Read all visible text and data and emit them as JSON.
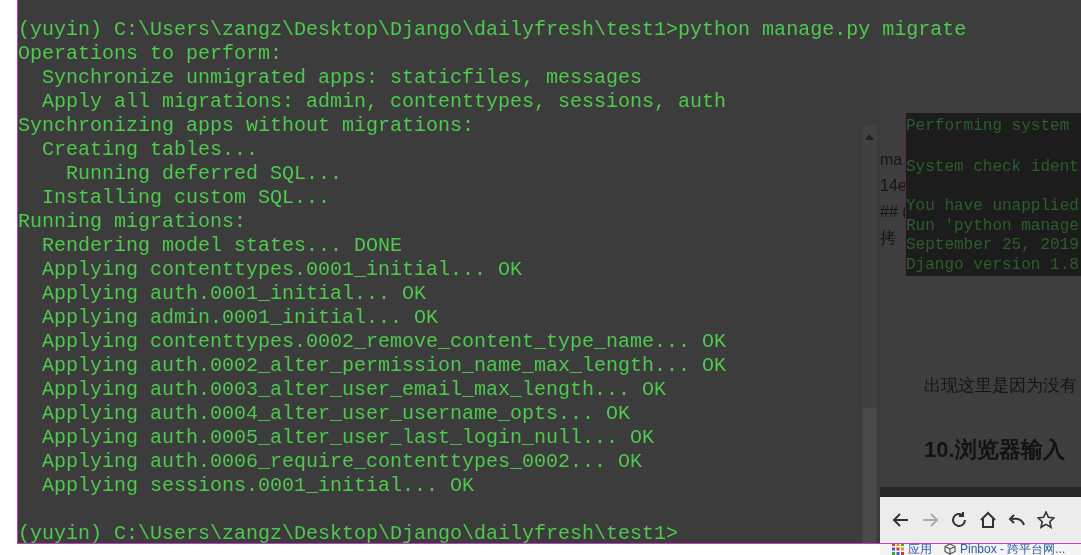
{
  "side_page": {
    "fragments": [
      "ma",
      "14e",
      "## (",
      "拷"
    ],
    "note": "出现这里是因为没有",
    "heading": "10.浏览器输入"
  },
  "server_console": {
    "lines": [
      "Performing system",
      "System check ident",
      "You have unapplied",
      "Run 'python manage",
      "September 25, 2019",
      "Django version 1.8"
    ]
  },
  "browser": {
    "bookmarks": [
      {
        "kind": "apps",
        "label": "应用"
      },
      {
        "kind": "page",
        "label": "Pinbox - 跨平台网..."
      }
    ]
  },
  "terminal": {
    "lines": [
      {
        "kind": "prompt",
        "text": "(yuyin) C:\\Users\\zangz\\Desktop\\Django\\dailyfresh\\test1>python manage.py migrate"
      },
      {
        "kind": "output",
        "text": "Operations to perform:"
      },
      {
        "kind": "output",
        "text": "  Synchronize unmigrated apps: staticfiles, messages"
      },
      {
        "kind": "output",
        "text": "  Apply all migrations: admin, contenttypes, sessions, auth"
      },
      {
        "kind": "output",
        "text": "Synchronizing apps without migrations:"
      },
      {
        "kind": "output",
        "text": "  Creating tables..."
      },
      {
        "kind": "output",
        "text": "    Running deferred SQL..."
      },
      {
        "kind": "output",
        "text": "  Installing custom SQL..."
      },
      {
        "kind": "output",
        "text": "Running migrations:"
      },
      {
        "kind": "output",
        "text": "  Rendering model states... DONE"
      },
      {
        "kind": "output",
        "text": "  Applying contenttypes.0001_initial... OK"
      },
      {
        "kind": "output",
        "text": "  Applying auth.0001_initial... OK"
      },
      {
        "kind": "output",
        "text": "  Applying admin.0001_initial... OK"
      },
      {
        "kind": "output",
        "text": "  Applying contenttypes.0002_remove_content_type_name... OK"
      },
      {
        "kind": "output",
        "text": "  Applying auth.0002_alter_permission_name_max_length... OK"
      },
      {
        "kind": "output",
        "text": "  Applying auth.0003_alter_user_email_max_length... OK"
      },
      {
        "kind": "output",
        "text": "  Applying auth.0004_alter_user_username_opts... OK"
      },
      {
        "kind": "output",
        "text": "  Applying auth.0005_alter_user_last_login_null... OK"
      },
      {
        "kind": "output",
        "text": "  Applying auth.0006_require_contenttypes_0002... OK"
      },
      {
        "kind": "output",
        "text": "  Applying sessions.0001_initial... OK"
      },
      {
        "kind": "prompt",
        "text": "(yuyin) C:\\Users\\zangz\\Desktop\\Django\\dailyfresh\\test1>"
      }
    ]
  }
}
